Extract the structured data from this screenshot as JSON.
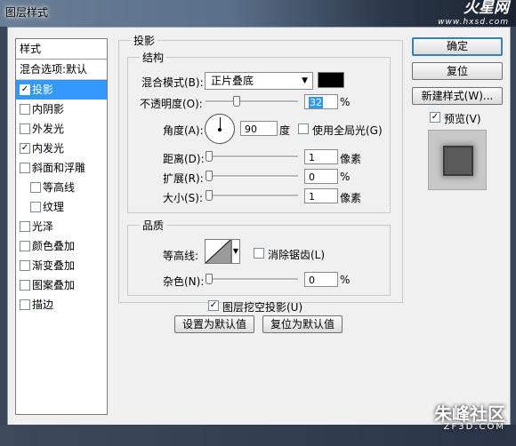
{
  "window": {
    "title": "图层样式"
  },
  "brand": {
    "main": "火星网",
    "sub": "www.hxsd.com"
  },
  "watermark": {
    "main": "朱峰社区",
    "sub": "ZF3D.COM"
  },
  "styles_panel": {
    "header": "样式",
    "blend_options": "混合选项:默认",
    "items": [
      {
        "label": "投影",
        "checked": true,
        "selected": true
      },
      {
        "label": "内阴影",
        "checked": false
      },
      {
        "label": "外发光",
        "checked": false
      },
      {
        "label": "内发光",
        "checked": true
      },
      {
        "label": "斜面和浮雕",
        "checked": false
      },
      {
        "label": "等高线",
        "checked": false
      },
      {
        "label": "纹理",
        "checked": false
      },
      {
        "label": "光泽",
        "checked": false
      },
      {
        "label": "颜色叠加",
        "checked": false
      },
      {
        "label": "渐变叠加",
        "checked": false
      },
      {
        "label": "图案叠加",
        "checked": false
      },
      {
        "label": "描边",
        "checked": false
      }
    ]
  },
  "drop_shadow": {
    "title": "投影",
    "structure": {
      "title": "结构",
      "blend_mode_label": "混合模式(B):",
      "blend_mode_value": "正片叠底",
      "shadow_color": "#000000",
      "opacity_label": "不透明度(O):",
      "opacity_value": "32",
      "opacity_unit": "%",
      "opacity_fraction": 0.32,
      "angle_label": "角度(A):",
      "angle_value": "90",
      "angle_unit": "度",
      "global_light_label": "使用全局光(G)",
      "global_light_checked": false,
      "distance_label": "距离(D):",
      "distance_value": "1",
      "distance_unit": "像素",
      "spread_label": "扩展(R):",
      "spread_value": "0",
      "spread_unit": "%",
      "size_label": "大小(S):",
      "size_value": "1",
      "size_unit": "像素"
    },
    "quality": {
      "title": "品质",
      "contour_label": "等高线:",
      "antialias_label": "消除锯齿(L)",
      "antialias_checked": false,
      "noise_label": "杂色(N):",
      "noise_value": "0",
      "noise_unit": "%"
    },
    "knockout_label": "图层挖空投影(U)",
    "knockout_checked": true,
    "make_default_label": "设置为默认值",
    "reset_default_label": "复位为默认值"
  },
  "actions": {
    "ok_label": "确定",
    "reset_label": "复位",
    "new_style_label": "新建样式(W)...",
    "preview_label": "预览(V)",
    "preview_checked": true
  }
}
